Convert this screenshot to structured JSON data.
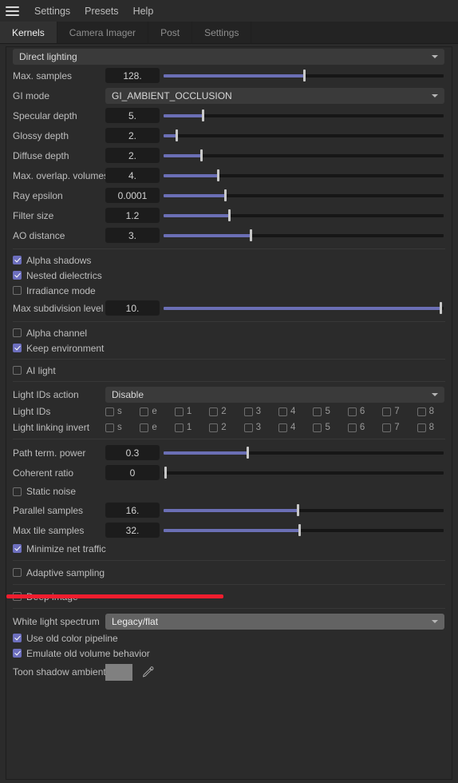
{
  "menubar": {
    "hamburger_icon": "hamburger-menu-icon",
    "items": [
      {
        "label": "Settings"
      },
      {
        "label": "Presets"
      },
      {
        "label": "Help"
      }
    ]
  },
  "tabs": [
    {
      "label": "Kernels",
      "active": true
    },
    {
      "label": "Camera Imager",
      "active": false
    },
    {
      "label": "Post",
      "active": false
    },
    {
      "label": "Settings",
      "active": false
    }
  ],
  "kernel_type": {
    "value": "Direct lighting",
    "arrow_icon": "chevron-down-icon"
  },
  "params": {
    "max_samples": {
      "label": "Max. samples",
      "value": "128.",
      "fill_pct": 50.0
    },
    "gi_mode": {
      "label": "GI mode",
      "value": "GI_AMBIENT_OCCLUSION"
    },
    "specular_depth": {
      "label": "Specular depth",
      "value": "5.",
      "fill_pct": 14.0
    },
    "glossy_depth": {
      "label": "Glossy depth",
      "value": "2.",
      "fill_pct": 4.5
    },
    "diffuse_depth": {
      "label": "Diffuse depth",
      "value": "2.",
      "fill_pct": 13.5
    },
    "max_overlap_volumes": {
      "label": "Max. overlap. volumes",
      "value": "4.",
      "fill_pct": 19.5
    },
    "ray_epsilon": {
      "label": "Ray epsilon",
      "value": "0.0001",
      "fill_pct": 22.0
    },
    "filter_size": {
      "label": "Filter size",
      "value": "1.2",
      "fill_pct": 23.5
    },
    "ao_distance": {
      "label": "AO distance",
      "value": "3.",
      "fill_pct": 31.0
    },
    "alpha_shadows": {
      "label": "Alpha shadows",
      "checked": true
    },
    "nested_dielectrics": {
      "label": "Nested dielectrics",
      "checked": true
    },
    "irradiance_mode": {
      "label": "Irradiance mode",
      "checked": false
    },
    "max_subdivision_level": {
      "label": "Max subdivision level",
      "value": "10.",
      "fill_pct": 99.0
    },
    "alpha_channel": {
      "label": "Alpha channel",
      "checked": false
    },
    "keep_environment": {
      "label": "Keep environment",
      "checked": true
    },
    "ai_light": {
      "label": "AI light",
      "checked": false
    },
    "light_ids_action": {
      "label": "Light IDs action",
      "value": "Disable"
    },
    "light_ids": {
      "label": "Light IDs"
    },
    "light_linking_invert": {
      "label": "Light linking invert"
    },
    "path_term_power": {
      "label": "Path term. power",
      "value": "0.3",
      "fill_pct": 30.0
    },
    "coherent_ratio": {
      "label": "Coherent ratio",
      "value": "0",
      "fill_pct": 0.5
    },
    "static_noise": {
      "label": "Static noise",
      "checked": false
    },
    "parallel_samples": {
      "label": "Parallel samples",
      "value": "16.",
      "fill_pct": 48.0
    },
    "max_tile_samples": {
      "label": "Max tile samples",
      "value": "32.",
      "fill_pct": 48.5
    },
    "minimize_net_traffic": {
      "label": "Minimize net traffic",
      "checked": true
    },
    "adaptive_sampling": {
      "label": "Adaptive sampling",
      "checked": false
    },
    "deep_image": {
      "label": "Deep image",
      "checked": false
    },
    "white_light_spectrum": {
      "label": "White light spectrum",
      "value": "Legacy/flat"
    },
    "use_old_color_pipeline": {
      "label": "Use old color pipeline",
      "checked": true
    },
    "emulate_old_volume": {
      "label": "Emulate old volume behavior",
      "checked": true
    },
    "toon_shadow_ambient": {
      "label": "Toon shadow ambient",
      "swatch_color": "#808080",
      "picker_icon": "eyedropper-icon"
    }
  },
  "light_id_columns": [
    "s",
    "e",
    "1",
    "2",
    "3",
    "4",
    "5",
    "6",
    "7",
    "8"
  ],
  "annotation": {
    "color": "#f21d2e"
  },
  "colors": {
    "accent": "#6b6fb5",
    "checkbox_on": "#6d6fbe",
    "panel_bg": "#2b2b2b",
    "field_bg": "#1c1c1c",
    "dropdown_bg": "#3a3a3a",
    "dropdown_highlight": "#636363"
  }
}
